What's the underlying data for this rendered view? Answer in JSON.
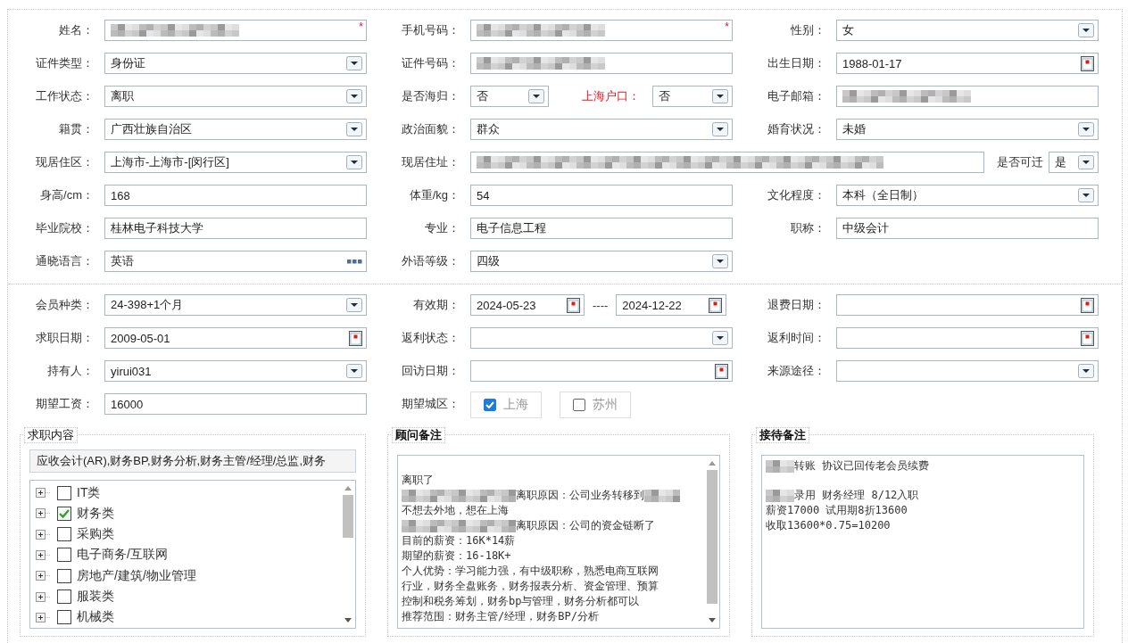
{
  "section_1": {
    "rows": [
      {
        "fields": [
          {
            "label": "姓名：",
            "kind": "text",
            "masked": true,
            "required_mark": "*"
          },
          {
            "label": "手机号码：",
            "kind": "text",
            "masked": true,
            "required_mark": "*"
          },
          {
            "label": "性别：",
            "kind": "select",
            "value": "女"
          }
        ]
      },
      {
        "fields": [
          {
            "label": "证件类型：",
            "kind": "select",
            "value": "身份证"
          },
          {
            "label": "证件号码：",
            "kind": "text",
            "masked": true
          },
          {
            "label": "出生日期：",
            "kind": "date",
            "value": "1988-01-17"
          }
        ]
      },
      {
        "fields": [
          {
            "label": "工作状态：",
            "kind": "select",
            "value": "离职"
          },
          {
            "label": "是否海归：",
            "kind": "select",
            "value": "否",
            "extra": {
              "label": "上海户口：",
              "kind": "select",
              "value": "否",
              "emphasis": true
            }
          },
          {
            "label": "电子邮箱：",
            "kind": "text",
            "masked": true
          }
        ]
      },
      {
        "fields": [
          {
            "label": "籍贯：",
            "kind": "select",
            "value": "广西壮族自治区"
          },
          {
            "label": "政治面貌：",
            "kind": "select",
            "value": "群众"
          },
          {
            "label": "婚育状况：",
            "kind": "select",
            "value": "未婚"
          }
        ]
      },
      {
        "fields": [
          {
            "label": "现居住区：",
            "kind": "select",
            "value": "上海市-上海市-[闵行区]"
          },
          {
            "label": "现居住址：",
            "kind": "text",
            "masked": true,
            "wide": true,
            "extra": {
              "label": "是否可迁",
              "kind": "select",
              "value": "是",
              "emphasis": false
            }
          }
        ]
      },
      {
        "fields": [
          {
            "label": "身高/cm：",
            "kind": "text",
            "value": "168"
          },
          {
            "label": "体重/kg：",
            "kind": "text",
            "value": "54"
          },
          {
            "label": "文化程度：",
            "kind": "select",
            "value": "本科（全日制）"
          }
        ]
      },
      {
        "fields": [
          {
            "label": "毕业院校：",
            "kind": "text",
            "value": "桂林电子科技大学"
          },
          {
            "label": "专业：",
            "kind": "text",
            "value": "电子信息工程"
          },
          {
            "label": "职称：",
            "kind": "text",
            "value": "中级会计"
          }
        ]
      },
      {
        "fields": [
          {
            "label": "通晓语言：",
            "kind": "picker",
            "value": "英语"
          },
          {
            "label": "外语等级：",
            "kind": "select",
            "value": "四级"
          }
        ]
      }
    ]
  },
  "section_2": {
    "rows": [
      {
        "fields": [
          {
            "label": "会员种类：",
            "kind": "select",
            "value": "24-398+1个月"
          },
          {
            "label": "有效期：",
            "kind": "date_range",
            "value": "2024-05-23",
            "separator": "----",
            "value_end": "2024-12-22"
          },
          {
            "label": "退费日期：",
            "kind": "date"
          }
        ]
      },
      {
        "fields": [
          {
            "label": "求职日期：",
            "kind": "date",
            "value": "2009-05-01"
          },
          {
            "label": "返利状态：",
            "kind": "select"
          },
          {
            "label": "返利时间：",
            "kind": "date"
          }
        ]
      },
      {
        "fields": [
          {
            "label": "持有人：",
            "kind": "select",
            "value": "yirui031"
          },
          {
            "label": "回访日期：",
            "kind": "date"
          },
          {
            "label": "来源途径：",
            "kind": "select"
          }
        ]
      },
      {
        "fields": [
          {
            "label": "期望工资：",
            "kind": "text",
            "value": "16000"
          },
          {
            "label": "期望城区：",
            "kind": "options",
            "options": [
              {
                "label": "上海",
                "checked": true
              },
              {
                "label": "苏州",
                "checked": false
              }
            ]
          }
        ]
      }
    ]
  },
  "panels": [
    {
      "kind": "tree",
      "title": "求职内容",
      "summary": "应收会计(AR),财务BP,财务分析,财务主管/经理/总监,财务",
      "items": [
        {
          "label": "IT类",
          "checked": false
        },
        {
          "label": "财务类",
          "checked": true
        },
        {
          "label": "采购类",
          "checked": false
        },
        {
          "label": "电子商务/互联网",
          "checked": false
        },
        {
          "label": "房地产/建筑/物业管理",
          "checked": false
        },
        {
          "label": "服装类",
          "checked": false
        },
        {
          "label": "机械类",
          "checked": false
        }
      ]
    },
    {
      "kind": "notes",
      "title": "顾问备注",
      "scrollable": true,
      "lines": [
        {
          "text": "离职了",
          "gap_before": true
        },
        {
          "text": "离职原因：公司业务转移到",
          "masked_before": true,
          "masked_after": true
        },
        {
          "text": "不想去外地，想在上海"
        },
        {
          "text": "离职原因：公司的资金链断了",
          "masked_before": true
        },
        {
          "text": "目前的薪资：16K*14薪"
        },
        {
          "text": "期望的薪资：16-18K+"
        },
        {
          "text": "个人优势：学习能力强，有中级职称，熟悉电商互联网"
        },
        {
          "text": "行业，财务全盘账务，财务报表分析、资金管理、预算"
        },
        {
          "text": "控制和税务筹划，财务bp与管理，财务分析都可以"
        },
        {
          "text": "推荐范围：财务主管/经理，财务BP/分析"
        }
      ]
    },
    {
      "kind": "notes",
      "title": "接待备注",
      "scrollable": false,
      "lines": [
        {
          "text": "转账 协议已回传老会员续费",
          "masked_before": true
        },
        {
          "text": "录用 财务经理  8/12入职",
          "masked_before": true,
          "gap_before": true
        },
        {
          "text": "薪资17000 试用期8折13600"
        },
        {
          "text": "收取13600*0.75=10200"
        }
      ]
    }
  ]
}
